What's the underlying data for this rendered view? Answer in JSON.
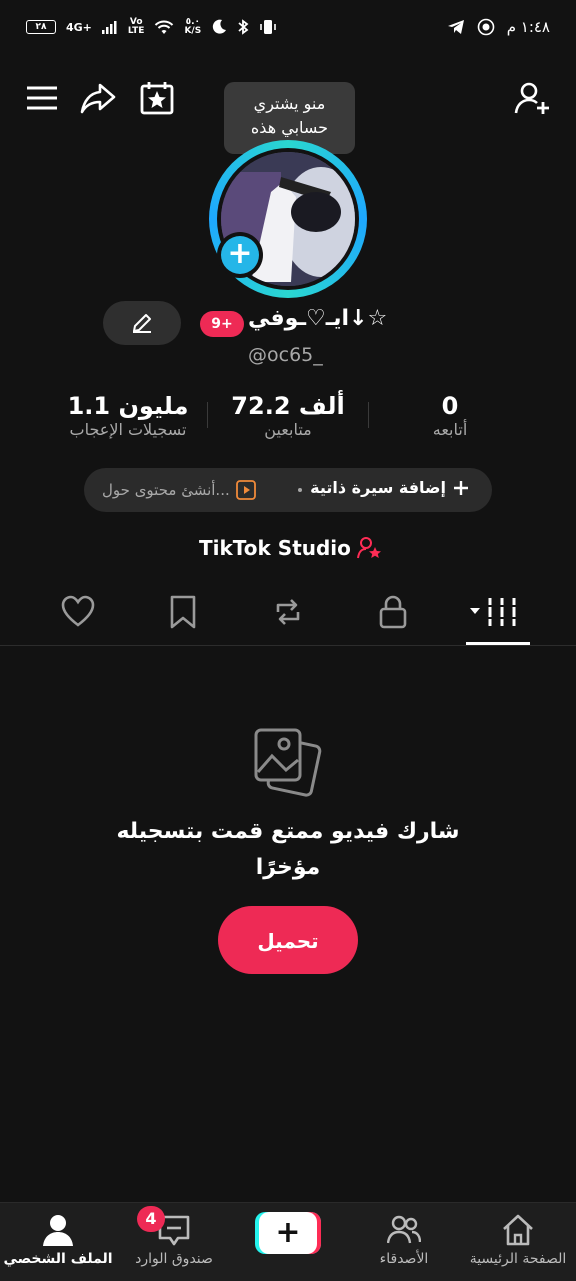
{
  "status_bar": {
    "time": "١:٤٨ م",
    "battery": "٢٨",
    "network": "4G+",
    "volte_top": "Vo",
    "volte_bottom": "LTE",
    "speed_top": "٥.٠",
    "speed_bottom": "K/S"
  },
  "tooltip": {
    "line1": "منو يشتري",
    "line2": "حسابي هذه"
  },
  "profile": {
    "badge": "9+",
    "username": "ايـ♡ـوفي↓☆",
    "handle": "@oc65_"
  },
  "stats": {
    "likes_value": "1.1 مليون",
    "likes_label": "تسجيلات الإعجاب",
    "followers_value": "72.2 ألف",
    "followers_label": "متابعين",
    "following_value": "0",
    "following_label": "أتابعه"
  },
  "bio": {
    "add_label": "إضافة سيرة ذاتية",
    "hint": "أنشئ محتوى حول..."
  },
  "studio": {
    "label": "TikTok Studio"
  },
  "empty_state": {
    "message": "شارك فيديو ممتع قمت بتسجيله مؤخرًا",
    "upload_label": "تحميل"
  },
  "bottom_nav": {
    "profile": "الملف الشخصي",
    "inbox": "صندوق الوارد",
    "inbox_badge": "4",
    "friends": "الأصدقاء",
    "home": "الصفحة الرئيسية"
  },
  "colors": {
    "accent": "#ee2a55",
    "ring": "#25b6e8",
    "background": "#121212"
  }
}
